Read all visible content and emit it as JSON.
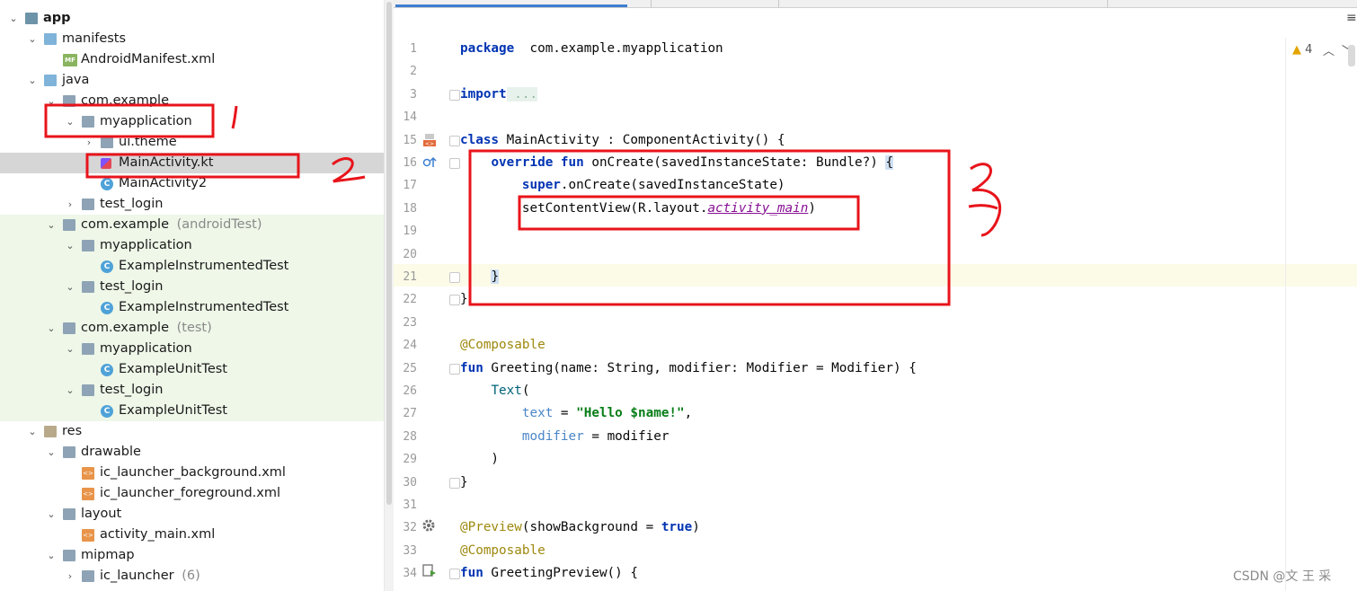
{
  "project_tree": [
    {
      "depth": 0,
      "expanded": true,
      "icon": "app-module-icon",
      "label": "app",
      "bold": true
    },
    {
      "depth": 1,
      "expanded": true,
      "icon": "folder-icon",
      "label": "manifests"
    },
    {
      "depth": 2,
      "leaf": true,
      "icon": "manifest-file-icon",
      "icon_text": "MF",
      "label": "AndroidManifest.xml"
    },
    {
      "depth": 1,
      "expanded": true,
      "icon": "folder-icon",
      "label": "java"
    },
    {
      "depth": 2,
      "expanded": true,
      "icon": "package-icon",
      "label": "com.example"
    },
    {
      "depth": 3,
      "expanded": true,
      "icon": "package-icon",
      "label": "myapplication"
    },
    {
      "depth": 4,
      "expanded": false,
      "icon": "package-icon",
      "label": "ui.theme"
    },
    {
      "depth": 4,
      "leaf": true,
      "icon": "kotlin-file-icon",
      "label": "MainActivity.kt",
      "selected": true
    },
    {
      "depth": 4,
      "leaf": true,
      "icon": "kotlin-class-icon",
      "icon_text": "C",
      "label": "MainActivity2"
    },
    {
      "depth": 3,
      "expanded": false,
      "icon": "package-icon",
      "label": "test_login"
    },
    {
      "depth": 2,
      "expanded": true,
      "icon": "package-icon",
      "label": "com.example",
      "suffix": "(androidTest)",
      "green": true
    },
    {
      "depth": 3,
      "expanded": true,
      "icon": "package-icon",
      "label": "myapplication",
      "green": true
    },
    {
      "depth": 4,
      "leaf": true,
      "icon": "kotlin-class-icon",
      "icon_text": "C",
      "label": "ExampleInstrumentedTest",
      "green": true
    },
    {
      "depth": 3,
      "expanded": true,
      "icon": "package-icon",
      "label": "test_login",
      "green": true
    },
    {
      "depth": 4,
      "leaf": true,
      "icon": "kotlin-class-icon",
      "icon_text": "C",
      "label": "ExampleInstrumentedTest",
      "green": true
    },
    {
      "depth": 2,
      "expanded": true,
      "icon": "package-icon",
      "label": "com.example",
      "suffix": "(test)",
      "green": true
    },
    {
      "depth": 3,
      "expanded": true,
      "icon": "package-icon",
      "label": "myapplication",
      "green": true
    },
    {
      "depth": 4,
      "leaf": true,
      "icon": "kotlin-class-icon",
      "icon_text": "C",
      "label": "ExampleUnitTest",
      "green": true
    },
    {
      "depth": 3,
      "expanded": true,
      "icon": "package-icon",
      "label": "test_login",
      "green": true
    },
    {
      "depth": 4,
      "leaf": true,
      "icon": "kotlin-class-icon",
      "icon_text": "C",
      "label": "ExampleUnitTest",
      "green": true
    },
    {
      "depth": 1,
      "expanded": true,
      "icon": "resources-folder-icon",
      "label": "res"
    },
    {
      "depth": 2,
      "expanded": true,
      "icon": "package-icon",
      "label": "drawable"
    },
    {
      "depth": 3,
      "leaf": true,
      "icon": "xml-file-icon",
      "icon_text": "<>",
      "label": "ic_launcher_background.xml"
    },
    {
      "depth": 3,
      "leaf": true,
      "icon": "xml-file-icon",
      "icon_text": "<>",
      "label": "ic_launcher_foreground.xml"
    },
    {
      "depth": 2,
      "expanded": true,
      "icon": "package-icon",
      "label": "layout"
    },
    {
      "depth": 3,
      "leaf": true,
      "icon": "xml-file-icon",
      "icon_text": "<>",
      "label": "activity_main.xml"
    },
    {
      "depth": 2,
      "expanded": true,
      "icon": "package-icon",
      "label": "mipmap"
    },
    {
      "depth": 3,
      "expanded": false,
      "icon": "package-icon",
      "label": "ic_launcher",
      "suffix": "(6)"
    }
  ],
  "editor": {
    "inspection_count": "4",
    "line_numbers": [
      "1",
      "2",
      "3",
      "14",
      "15",
      "16",
      "17",
      "18",
      "19",
      "20",
      "21",
      "22",
      "23",
      "24",
      "25",
      "26",
      "27",
      "28",
      "29",
      "30",
      "31",
      "32",
      "33",
      "34"
    ],
    "lines": [
      [
        [
          "kw",
          "package"
        ],
        [
          "",
          "  com.example.myapplication"
        ]
      ],
      [],
      [
        [
          "kw",
          "import"
        ],
        [
          "",
          ""
        ],
        [
          "fold",
          " ..."
        ]
      ],
      [],
      [
        [
          "kw",
          "class"
        ],
        [
          "",
          " MainActivity : ComponentActivity() {"
        ]
      ],
      [
        [
          "",
          "    "
        ],
        [
          "kw",
          "override fun"
        ],
        [
          "",
          " onCreate(savedInstanceState: Bundle?) "
        ],
        [
          "bracehl",
          "{"
        ]
      ],
      [
        [
          "",
          "        "
        ],
        [
          "kw",
          "super"
        ],
        [
          "",
          ".onCreate(savedInstanceState)"
        ]
      ],
      [
        [
          "",
          "        setContentView(R.layout."
        ],
        [
          "italic-link",
          "activity_main"
        ],
        [
          "",
          ")"
        ]
      ],
      [],
      [],
      [
        [
          "",
          "    "
        ],
        [
          "bracehl",
          "}"
        ]
      ],
      [
        [
          "",
          "}"
        ]
      ],
      [],
      [
        [
          "ann",
          "@Composable"
        ]
      ],
      [
        [
          "kw",
          "fun"
        ],
        [
          "",
          " Greeting(name: String, modifier: Modifier = Modifier) {"
        ]
      ],
      [
        [
          "",
          "    "
        ],
        [
          "fn",
          "Text"
        ],
        [
          "",
          "("
        ]
      ],
      [
        [
          "",
          "        "
        ],
        [
          "param",
          "text"
        ],
        [
          "",
          " = "
        ],
        [
          "str",
          "\"Hello $name!\""
        ],
        [
          "",
          ","
        ]
      ],
      [
        [
          "",
          "        "
        ],
        [
          "param",
          "modifier"
        ],
        [
          "",
          " = modifier"
        ]
      ],
      [
        [
          "",
          "    )"
        ]
      ],
      [
        [
          "",
          "}"
        ]
      ],
      [],
      [
        [
          "ann",
          "@Preview"
        ],
        [
          "",
          "(showBackground = "
        ],
        [
          "kw",
          "true"
        ],
        [
          "",
          ")"
        ]
      ],
      [
        [
          "ann",
          "@Composable"
        ]
      ],
      [
        [
          "kw",
          "fun"
        ],
        [
          "",
          " GreetingPreview() {"
        ]
      ]
    ]
  },
  "annotations": {
    "mark_1": "1",
    "mark_2": "2",
    "mark_3": "3",
    "annotation_color": "#e8141b"
  },
  "watermark": "CSDN @文 王 采"
}
